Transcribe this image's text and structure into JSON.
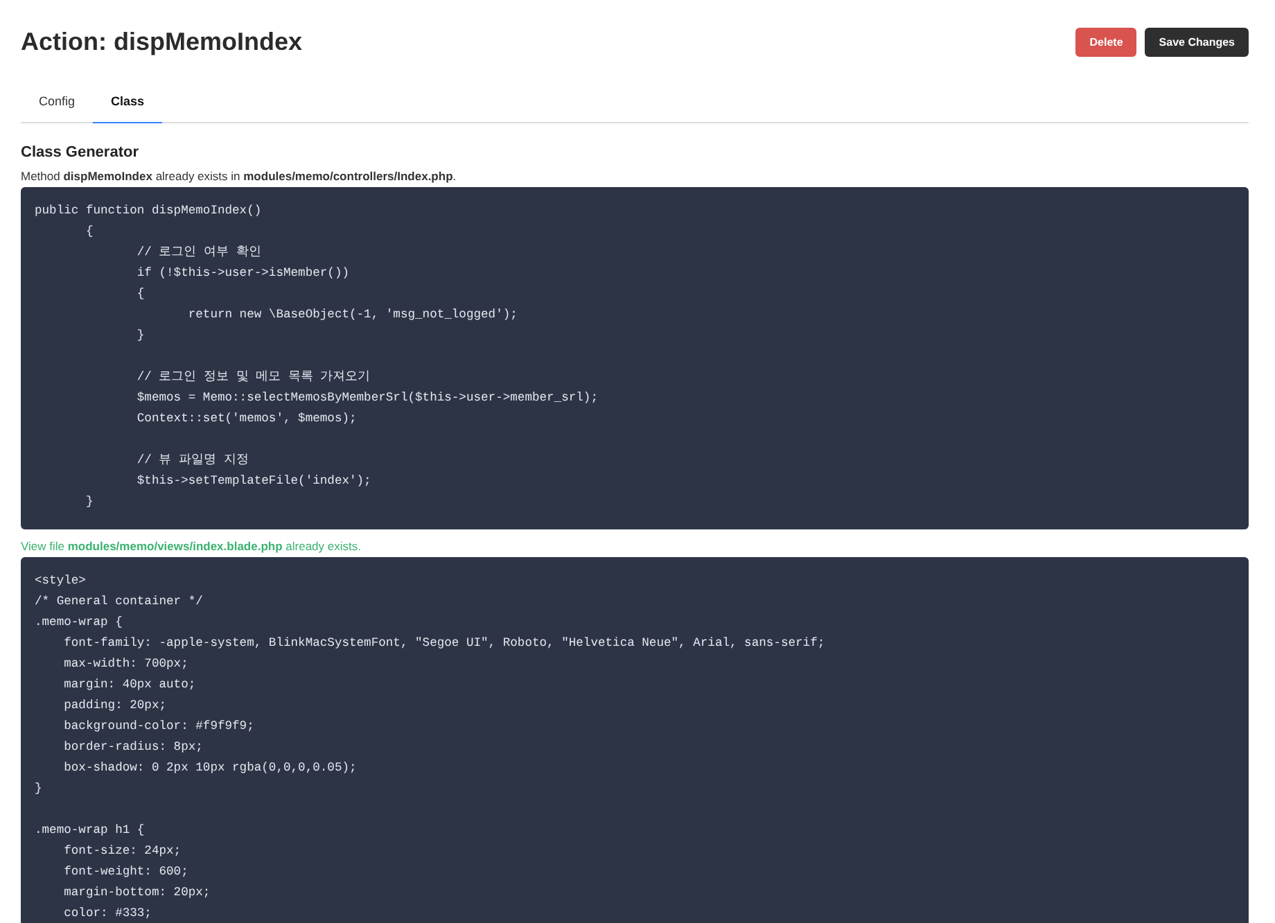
{
  "header": {
    "title": "Action: dispMemoIndex",
    "buttons": [
      {
        "label": "Delete",
        "kind": "danger"
      },
      {
        "label": "Save Changes",
        "kind": "primary"
      }
    ]
  },
  "tabs": [
    {
      "label": "Config",
      "selected": false
    },
    {
      "label": "Class",
      "selected": true
    }
  ],
  "section": {
    "title": "Class Generator",
    "blocks": [
      {
        "message": "Method **dispMemoIndex** already exists in **modules/memo/controllers/Index.php**.",
        "kind": "neutral",
        "code": "public function dispMemoIndex()\n\t{\n\t\t// 로그인 여부 확인\n\t\tif (!$this->user->isMember())\n\t\t{\n\t\t\treturn new \\BaseObject(-1, 'msg_not_logged');\n\t\t}\n\n\t\t// 로그인 정보 및 메모 목록 가져오기\n\t\t$memos = Memo::selectMemosByMemberSrl($this->user->member_srl);\n\t\tContext::set('memos', $memos);\n\n\t\t// 뷰 파일명 지정\n\t\t$this->setTemplateFile('index');\n\t}"
      },
      {
        "message": "View file **modules/memo/views/index.blade.php** already exists.",
        "kind": "success",
        "code": "<style>\n/* General container */\n.memo-wrap {\n    font-family: -apple-system, BlinkMacSystemFont, \"Segoe UI\", Roboto, \"Helvetica Neue\", Arial, sans-serif;\n    max-width: 700px;\n    margin: 40px auto;\n    padding: 20px;\n    background-color: #f9f9f9;\n    border-radius: 8px;\n    box-shadow: 0 2px 10px rgba(0,0,0,0.05);\n}\n\n.memo-wrap h1 {\n    font-size: 24px;\n    font-weight: 600;\n    margin-bottom: 20px;\n    color: #333;"
      }
    ]
  }
}
